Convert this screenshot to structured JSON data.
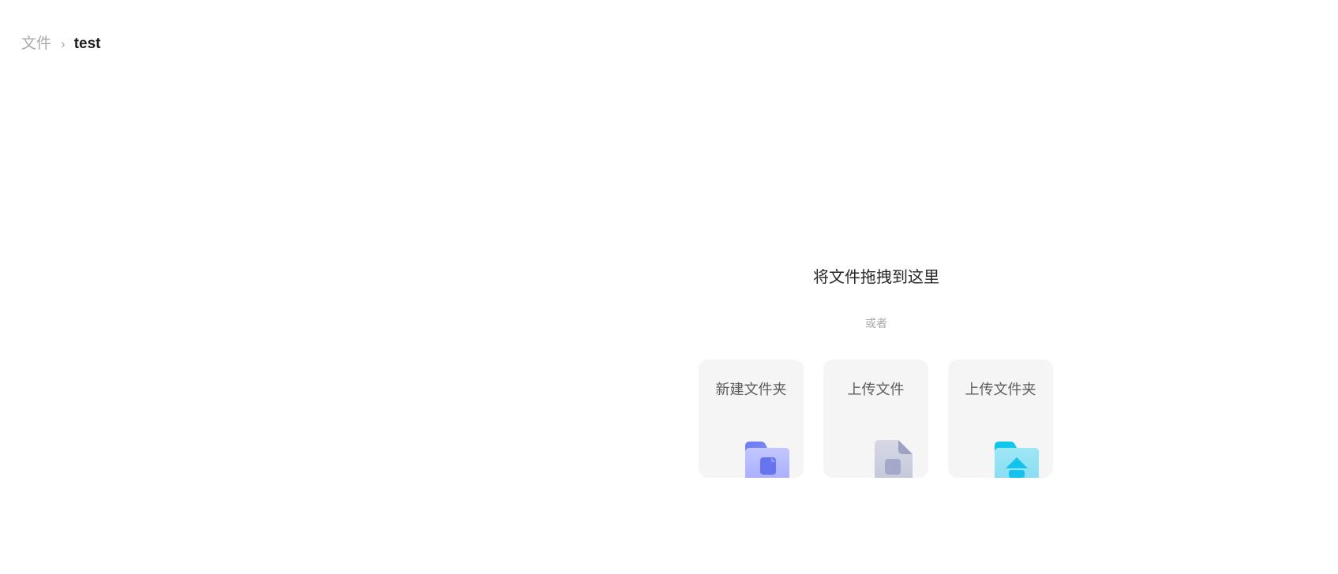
{
  "breadcrumb": {
    "root": "文件",
    "separator": "›",
    "current": "test"
  },
  "drop_zone": {
    "title": "将文件拖拽到这里",
    "or_text": "或者"
  },
  "actions": [
    {
      "label": "新建文件夹",
      "icon": "new-folder-icon"
    },
    {
      "label": "上传文件",
      "icon": "upload-file-icon"
    },
    {
      "label": "上传文件夹",
      "icon": "upload-folder-icon"
    }
  ],
  "colors": {
    "card_bg": "#f5f5f5",
    "folder_accent": "#6b7cf5",
    "file_accent": "#a8abc8",
    "upload_folder_accent": "#1cc7ee"
  }
}
